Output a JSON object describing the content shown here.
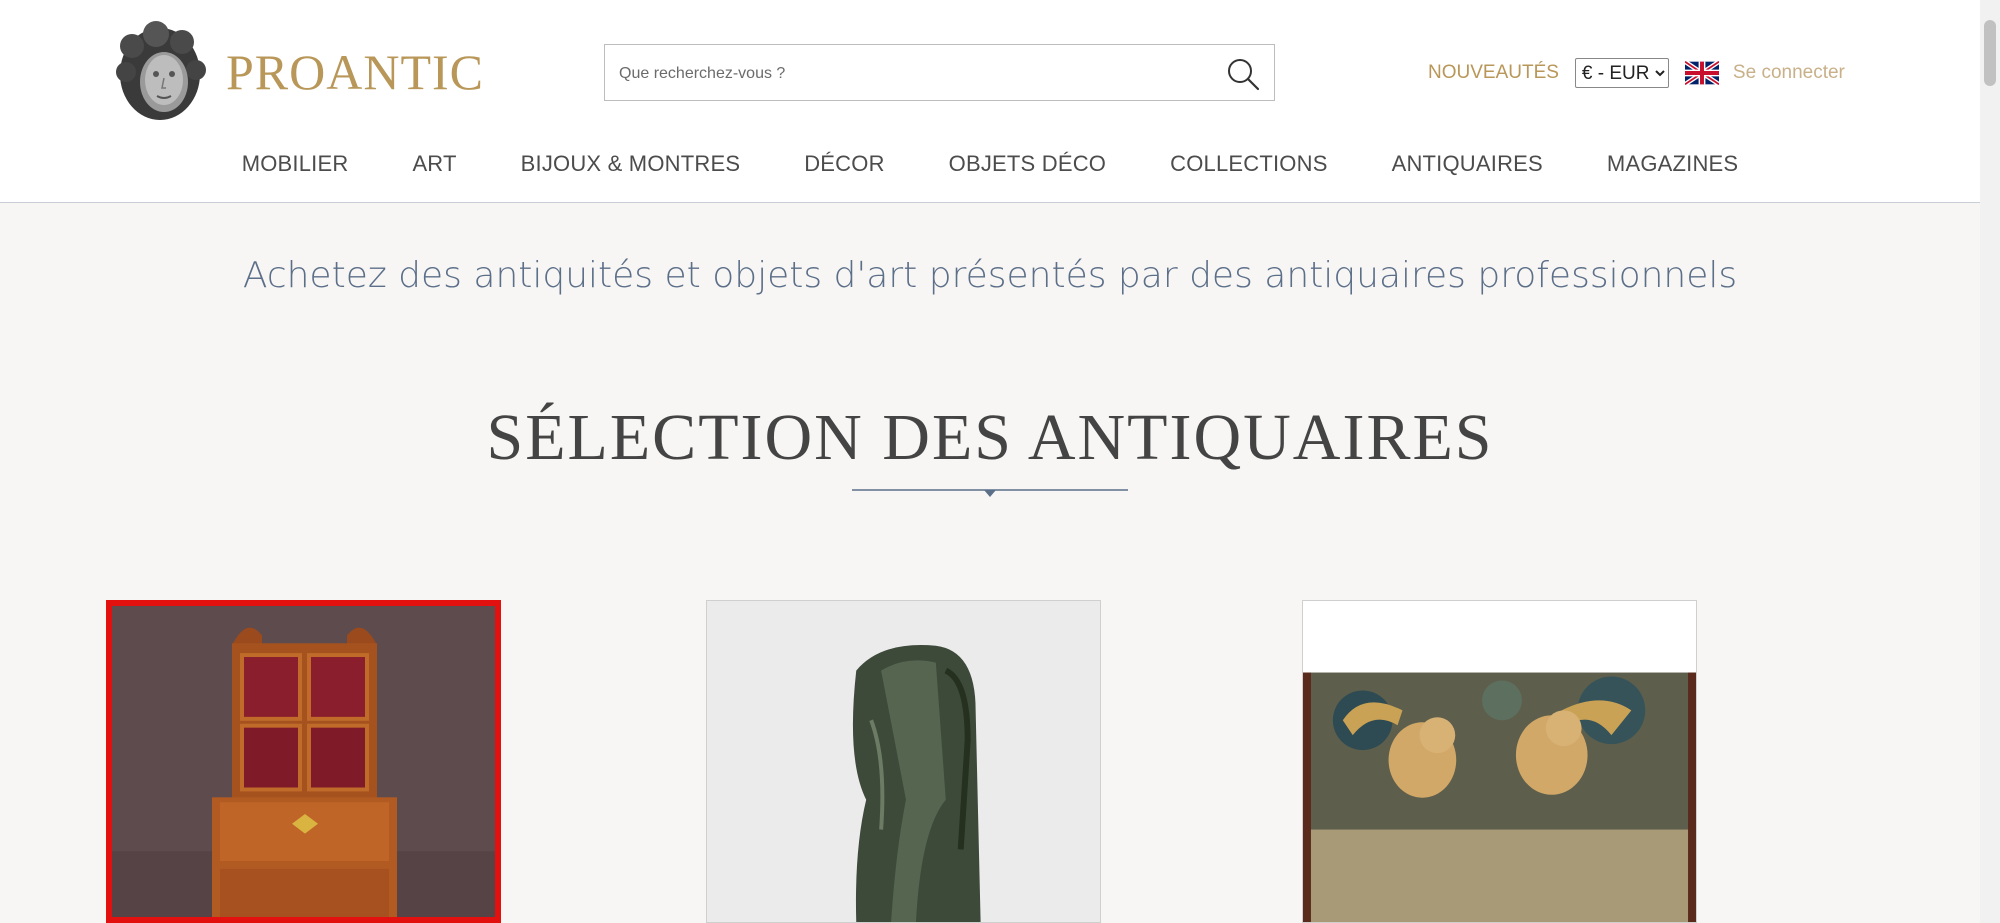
{
  "header": {
    "logo_text": "PROANTIC",
    "search": {
      "placeholder": "Que recherchez-vous ?",
      "value": ""
    },
    "nouveautes": "NOUVEAUTÉS",
    "currency": {
      "selected": "€ - EUR",
      "options": [
        "€ - EUR"
      ]
    },
    "language_flag": "uk-flag-icon",
    "login": "Se connecter"
  },
  "nav": {
    "items": [
      {
        "label": "MOBILIER"
      },
      {
        "label": "ART"
      },
      {
        "label": "BIJOUX & MONTRES"
      },
      {
        "label": "DÉCOR"
      },
      {
        "label": "OBJETS DÉCO"
      },
      {
        "label": "COLLECTIONS"
      },
      {
        "label": "ANTIQUAIRES"
      },
      {
        "label": "MAGAZINES"
      }
    ]
  },
  "main": {
    "tagline": "Achetez des antiquités et objets d'art présentés par des antiquaires professionnels",
    "section_title": "SÉLECTION DES ANTIQUAIRES",
    "cards": [
      {
        "image": "secretary-bookcase-image",
        "selected": true
      },
      {
        "image": "draped-bronze-sculpture-image",
        "selected": false
      },
      {
        "image": "tapestry-putti-image",
        "selected": false
      }
    ]
  },
  "colors": {
    "brand_gold": "#b89758",
    "tagline_blue": "#5c6f89",
    "selection_red": "#e31010",
    "background": "#f7f6f4"
  }
}
